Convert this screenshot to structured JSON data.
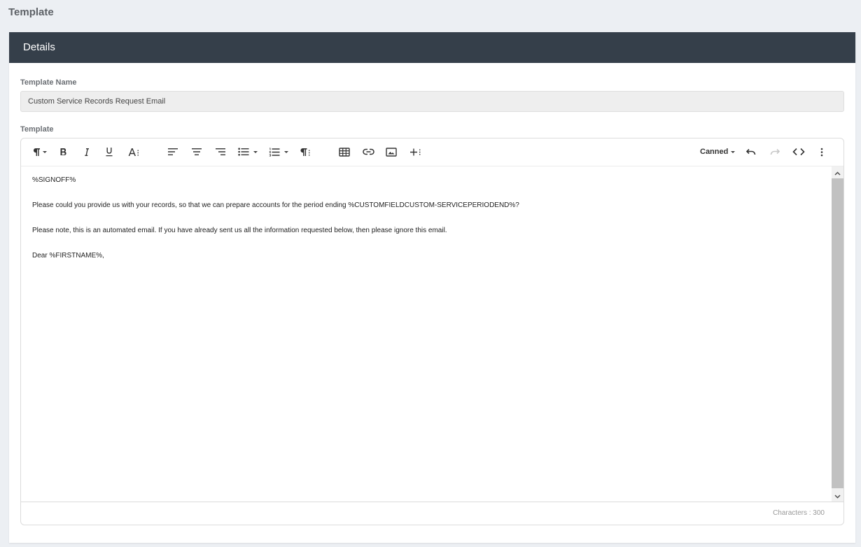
{
  "page": {
    "title": "Template"
  },
  "card": {
    "header": "Details"
  },
  "form": {
    "template_name_label": "Template Name",
    "template_name_value": "Custom Service Records Request Email",
    "template_label": "Template"
  },
  "toolbar": {
    "buttons": [
      "paragraph-format",
      "bold",
      "italic",
      "underline",
      "font-size",
      "align-left",
      "align-center",
      "align-right",
      "unordered-list",
      "ordered-list",
      "paragraph-style",
      "insert-table",
      "insert-link",
      "insert-image",
      "more",
      "undo",
      "redo",
      "code-view",
      "more-options"
    ],
    "canned_label": "Canned"
  },
  "editor": {
    "lines": [
      "%SIGNOFF%",
      "Please could you provide us with your records, so that we can prepare accounts for the period ending %CUSTOMFIELDCUSTOM-SERVICEPERIODEND%?",
      "Please note, this is an automated email. If you have already sent us all the information requested below, then please ignore this email.",
      "Dear %FIRSTNAME%,"
    ],
    "character_count": "Characters : 300"
  },
  "colors": {
    "header_bg": "#353f4a",
    "page_bg": "#eceff3",
    "input_bg": "#eeeeee"
  }
}
